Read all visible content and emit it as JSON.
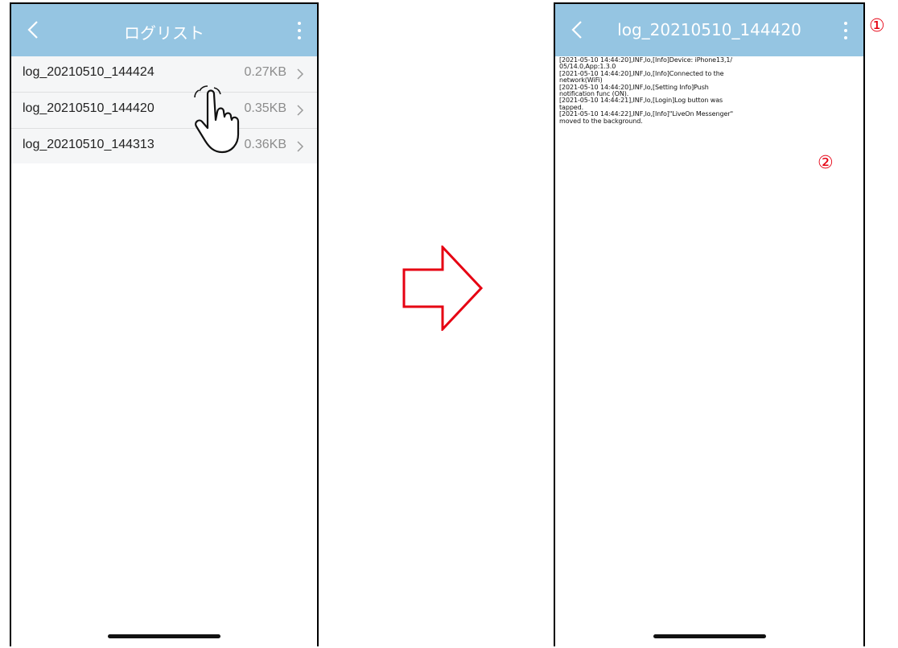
{
  "left_screen": {
    "title": "ログリスト",
    "items": [
      {
        "name": "log_20210510_144424",
        "size": "0.27KB"
      },
      {
        "name": "log_20210510_144420",
        "size": "0.35KB"
      },
      {
        "name": "log_20210510_144313",
        "size": "0.36KB"
      }
    ],
    "pointer": "hand-pointer-icon"
  },
  "right_screen": {
    "title": "log_20210510_144420",
    "log_text": "[2021-05-10 14:44:20],INF,lo,[Info]Device: iPhone13,1/\n05/14.0,App:1.3.0\n[2021-05-10 14:44:20],INF,lo,[Info]Connected to the\nnetwork(WiFi)\n[2021-05-10 14:44:20],INF,lo,[Setting Info]Push\nnotification func (ON).\n[2021-05-10 14:44:21],INF,lo,[Login]Log button was\ntapped.\n[2021-05-10 14:44:22],INF,lo,[Info]\"LiveOn Messenger\"\nmoved to the background."
  },
  "callouts": {
    "one": "①",
    "two": "②"
  },
  "colors": {
    "navbar": "#95c5e2",
    "arrow": "#e60012",
    "callout": "#e60012"
  }
}
